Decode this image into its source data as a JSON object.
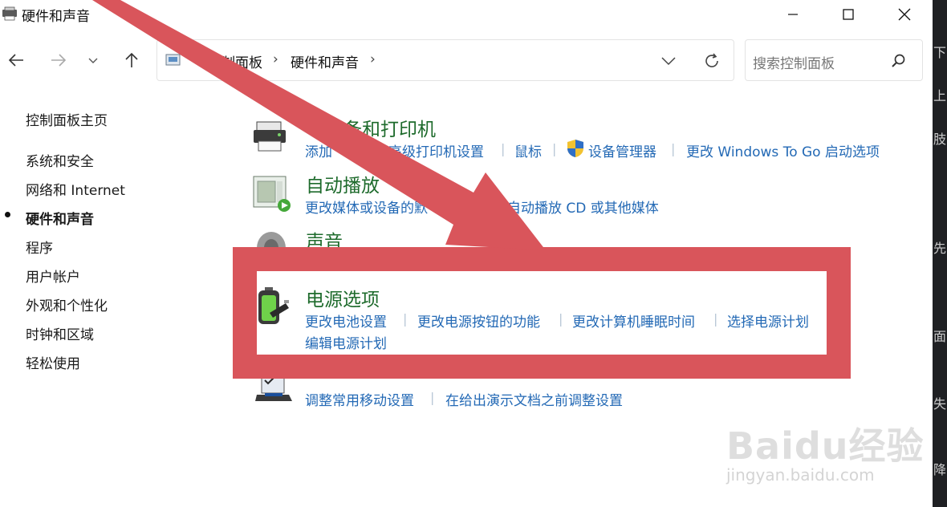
{
  "window": {
    "title": "硬件和声音"
  },
  "nav": {
    "breadcrumb_root": "控制面板",
    "breadcrumb_current": "硬件和声音",
    "search_placeholder": "搜索控制面板"
  },
  "sidebar": {
    "home": "控制面板主页",
    "items": [
      {
        "label": "系统和安全"
      },
      {
        "label": "网络和 Internet"
      },
      {
        "label": "硬件和声音",
        "selected": true
      },
      {
        "label": "程序"
      },
      {
        "label": "用户帐户"
      },
      {
        "label": "外观和个性化"
      },
      {
        "label": "时钟和区域"
      },
      {
        "label": "轻松使用"
      }
    ]
  },
  "categories": {
    "devices": {
      "title_visible": "备和打印机",
      "link_1_visible": "添加",
      "link_2": "高级打印机设置",
      "link_3": "鼠标",
      "link_4": "设备管理器",
      "link_5": "更改 Windows To Go 启动选项"
    },
    "autoplay": {
      "title": "自动播放",
      "link_1_visible": "更改媒体或设备的默",
      "link_2_visible": "自动播放 CD 或其他媒体"
    },
    "sound": {
      "title": "声音"
    },
    "power": {
      "title": "电源选项",
      "link_1": "更改电池设置",
      "link_2": "更改电源按钮的功能",
      "link_3": "更改计算机睡眠时间",
      "link_4": "选择电源计划",
      "link_5": "编辑电源计划"
    },
    "mobility": {
      "link_1": "调整常用移动设置",
      "link_2": "在给出演示文档之前调整设置"
    }
  },
  "side_strip": [
    "下",
    "上",
    "肢",
    "先",
    "面",
    "失",
    "降"
  ],
  "watermark": {
    "logo": "Baidu经验",
    "url": "jingyan.baidu.com"
  },
  "colors": {
    "annotation_red": "#d9555b",
    "category_green": "#1e6b2c",
    "link_blue": "#2369b5"
  }
}
